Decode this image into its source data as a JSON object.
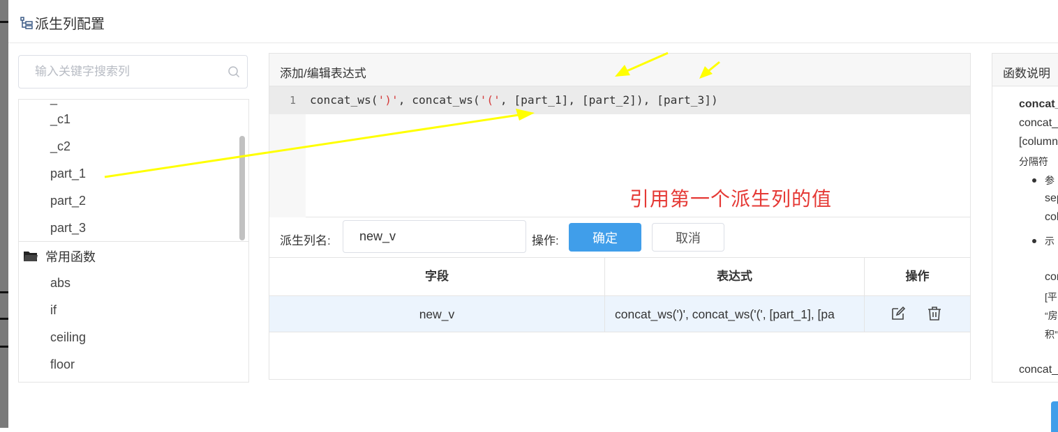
{
  "dialog": {
    "title": "派生列配置",
    "title_icon": "tree-structure-icon"
  },
  "left": {
    "search_placeholder": "输入关键字搜索列",
    "columns": [
      "_c1",
      "_c2",
      "part_1",
      "part_2",
      "part_3"
    ],
    "function_group": "常用函数",
    "functions": [
      "abs",
      "if",
      "ceiling",
      "floor"
    ]
  },
  "editor": {
    "header": "添加/编辑表达式",
    "line_number": "1",
    "code": {
      "t1": "concat_ws(",
      "s1": "')'",
      "t2": ", concat_ws(",
      "s2": "'('",
      "t3": ", [part_1], [part_2]), [part_3])"
    },
    "annotation": "引用第一个派生列的值",
    "name_label": "派生列名:",
    "name_value": "new_v",
    "op_label": "操作:",
    "confirm": "确定",
    "cancel": "取消"
  },
  "table": {
    "headers": [
      "字段",
      "表达式",
      "操作"
    ],
    "rows": [
      {
        "field": "new_v",
        "expression": "concat_ws(')', concat_ws('(', [part_1], [pa"
      }
    ],
    "action_icons": [
      "edit-icon",
      "trash-icon"
    ]
  },
  "docs": {
    "header": "函数说明",
    "lines": [
      "concat_",
      "concat_",
      "[column",
      "分隔符",
      "参",
      "sep",
      "col",
      "示",
      "con",
      "[平",
      "“房",
      "积”",
      "concat_"
    ]
  },
  "colors": {
    "primary": "#409eea",
    "annotation_red": "#e53935",
    "arrow_yellow": "#ffff00",
    "row_highlight": "#ecf4fd"
  }
}
